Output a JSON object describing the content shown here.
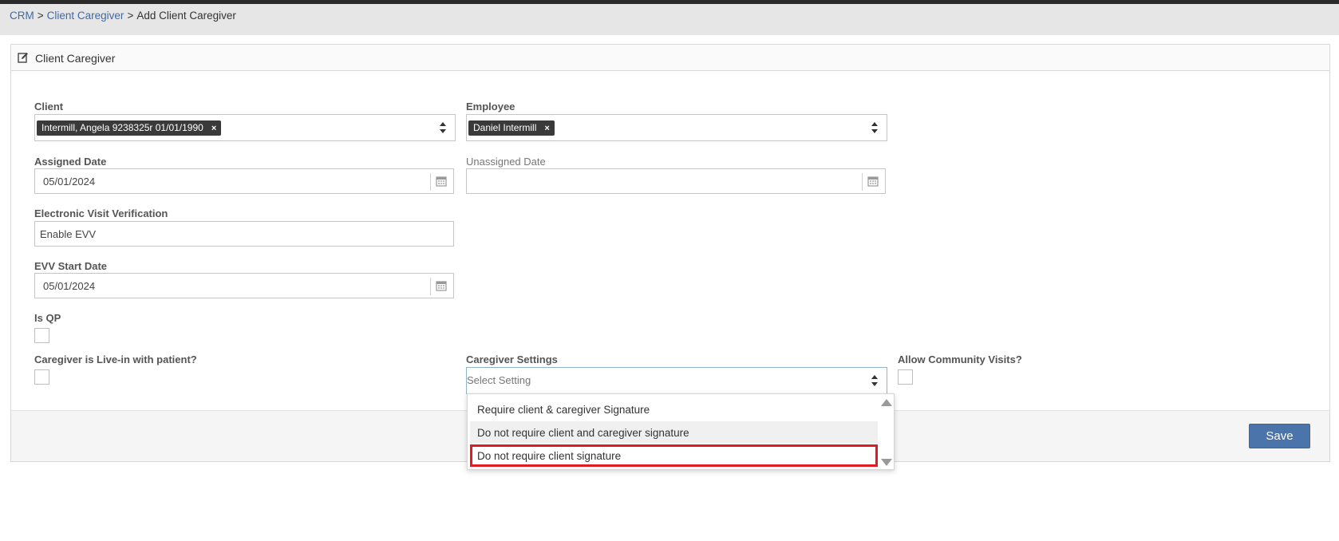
{
  "breadcrumb": {
    "crm": "CRM",
    "sep1": ">",
    "client_caregiver": "Client Caregiver",
    "sep2": ">",
    "current": "Add Client Caregiver"
  },
  "panel": {
    "title": "Client Caregiver"
  },
  "form": {
    "client": {
      "label": "Client",
      "tag": "Intermill, Angela 9238325r 01/01/1990",
      "remove": "×"
    },
    "employee": {
      "label": "Employee",
      "tag": "Daniel Intermill",
      "remove": "×"
    },
    "assigned_date": {
      "label": "Assigned Date",
      "value": "05/01/2024"
    },
    "unassigned_date": {
      "label": "Unassigned Date",
      "value": ""
    },
    "evv": {
      "label": "Electronic Visit Verification",
      "value": "Enable EVV"
    },
    "evv_start_date": {
      "label": "EVV Start Date",
      "value": "05/01/2024"
    },
    "is_qp": {
      "label": "Is QP"
    },
    "live_in": {
      "label": "Caregiver is Live-in with patient?"
    },
    "caregiver_settings": {
      "label": "Caregiver Settings",
      "placeholder": "Select Setting",
      "options": [
        "Require client & caregiver Signature",
        "Do not require client and caregiver signature",
        "Do not require client signature"
      ]
    },
    "community_visits": {
      "label": "Allow Community Visits?"
    }
  },
  "footer": {
    "save_label": "Save"
  },
  "colors": {
    "accent": "#4a74aa",
    "link": "#3d6aa8",
    "highlight": "#e01b24",
    "tag_bg": "#3a3a3a"
  }
}
